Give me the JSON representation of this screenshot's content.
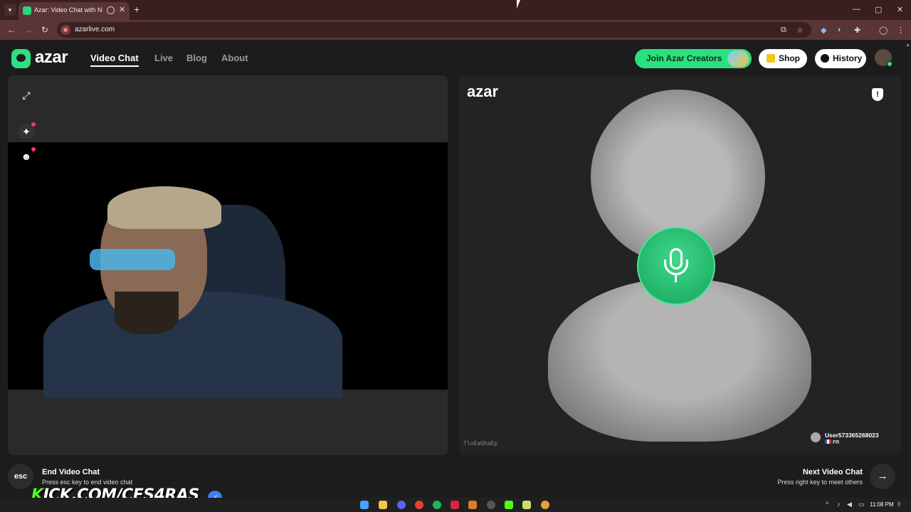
{
  "browser": {
    "tab_title": "Azar: Video Chat with New",
    "tab_close": "✕",
    "new_tab": "+",
    "url": "azarlive.com",
    "window_controls": [
      "—",
      "▢",
      "✕"
    ]
  },
  "header": {
    "logo": "azar",
    "nav": [
      {
        "label": "Video Chat",
        "active": true
      },
      {
        "label": "Live",
        "active": false
      },
      {
        "label": "Blog",
        "active": false
      },
      {
        "label": "About",
        "active": false
      }
    ],
    "join_creators": "Join Azar Creators",
    "shop": "Shop",
    "history": "History"
  },
  "remote": {
    "logo": "azar",
    "room_code": "TloEaUhaEp",
    "username": "User573365268023",
    "country": "FR"
  },
  "footer": {
    "esc_key": "esc",
    "end_title": "End Video Chat",
    "end_sub": "Press esc key to end video chat",
    "next_title": "Next Video Chat",
    "next_sub": "Press right key to meet others",
    "next_arrow": "→"
  },
  "overlay": {
    "watermark_k": "K",
    "watermark_rest": "ICK.COM/CES4RAS"
  },
  "taskbar": {
    "clock": "11:08 PM"
  },
  "colors": {
    "brand_green": "#2ce07f",
    "tab_bar": "#3a1f1f",
    "background": "#1c1c1c"
  }
}
